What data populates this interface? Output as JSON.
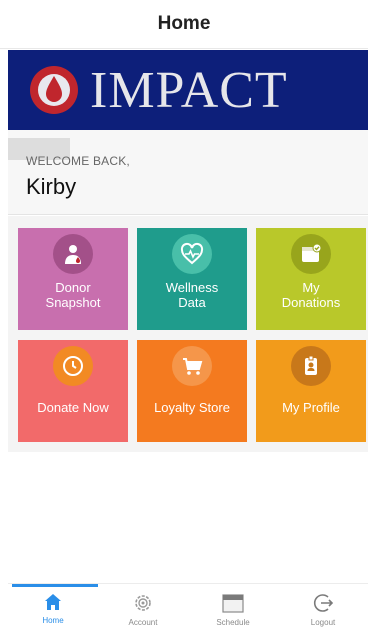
{
  "header": {
    "title": "Home"
  },
  "banner": {
    "brand": "IMPACT",
    "bg_color": "#0d1f7a"
  },
  "welcome": {
    "label": "WELCOME BACK,",
    "user_name": "Kirby"
  },
  "tiles": [
    {
      "label": "Donor\nSnapshot",
      "icon": "donor-person-icon",
      "color": "#c86fae"
    },
    {
      "label": "Wellness\nData",
      "icon": "heart-monitor-icon",
      "color": "#1f9c8c"
    },
    {
      "label": "My\nDonations",
      "icon": "calendar-check-icon",
      "color": "#b9c82a"
    },
    {
      "label": "Donate Now",
      "icon": "clock-icon",
      "color": "#f26a6a"
    },
    {
      "label": "Loyalty Store",
      "icon": "cart-icon",
      "color": "#f47a1f"
    },
    {
      "label": "My Profile",
      "icon": "id-badge-icon",
      "color": "#f29b1b"
    }
  ],
  "tab_bar": {
    "active_color": "#2a8ee8",
    "items": [
      {
        "label": "Home",
        "icon": "home-icon",
        "active": true
      },
      {
        "label": "Account",
        "icon": "gear-icon",
        "active": false
      },
      {
        "label": "Schedule",
        "icon": "calendar-icon",
        "active": false
      },
      {
        "label": "Logout",
        "icon": "logout-icon",
        "active": false
      }
    ]
  }
}
